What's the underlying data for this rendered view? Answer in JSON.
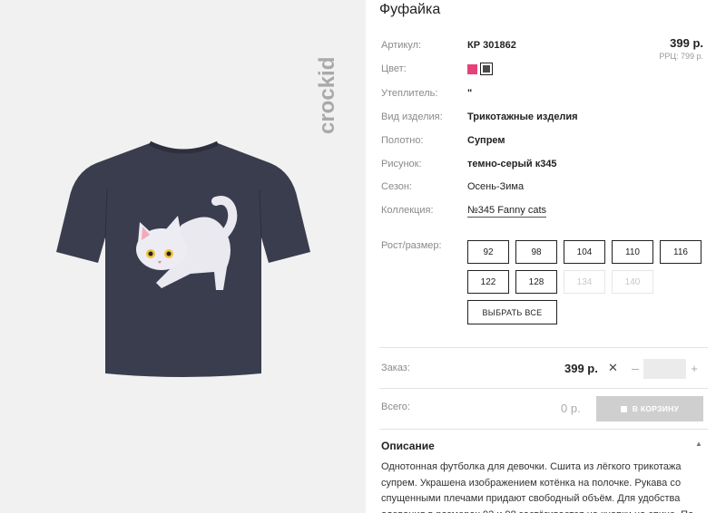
{
  "product": {
    "title": "Фуфайка",
    "price": "399 р.",
    "rrp": "РРЦ: 799 р."
  },
  "brand_text": "crockid",
  "properties": {
    "article": {
      "label": "Артикул:",
      "value": "КР 301862"
    },
    "color": {
      "label": "Цвет:"
    },
    "insulation": {
      "label": "Утеплитель:",
      "value": "\""
    },
    "type": {
      "label": "Вид изделия:",
      "value": "Трикотажные изделия"
    },
    "fabric": {
      "label": "Полотно:",
      "value": "Супрем"
    },
    "print": {
      "label": "Рисунок:",
      "value": "темно-серый к345"
    },
    "season": {
      "label": "Сезон:",
      "value": "Осень-Зима"
    },
    "collection": {
      "label": "Коллекция:",
      "value": "№345 Fanny cats"
    }
  },
  "colors": {
    "pink": "#e8407a",
    "dark": "#4a4a4a",
    "shirt": "#3a3d4e"
  },
  "sizes": {
    "label": "Рост/размер:",
    "items": [
      {
        "label": "92",
        "available": true
      },
      {
        "label": "98",
        "available": true
      },
      {
        "label": "104",
        "available": true
      },
      {
        "label": "110",
        "available": true
      },
      {
        "label": "116",
        "available": true
      },
      {
        "label": "122",
        "available": true
      },
      {
        "label": "128",
        "available": true
      },
      {
        "label": "134",
        "available": false
      },
      {
        "label": "140",
        "available": false
      }
    ],
    "select_all": "ВЫБРАТЬ ВСЕ"
  },
  "order": {
    "label": "Заказ:",
    "price": "399 р.",
    "times": "✕",
    "minus": "–",
    "plus": "+",
    "quantity": ""
  },
  "total": {
    "label": "Всего:",
    "value": "0 р.",
    "cart_button": "В КОРЗИНУ"
  },
  "description": {
    "heading": "Описание",
    "toggle": "▲",
    "text": "Однотонная футболка для девочки. Сшита из лёгкого трикотажа супрем. Украшена изображением котёнка на полочке. Рукава со спущенными плечами придают свободный объём. Для удобства одевания в размерах 92 и 98 застёгивается на кнопки на спине. По"
  }
}
